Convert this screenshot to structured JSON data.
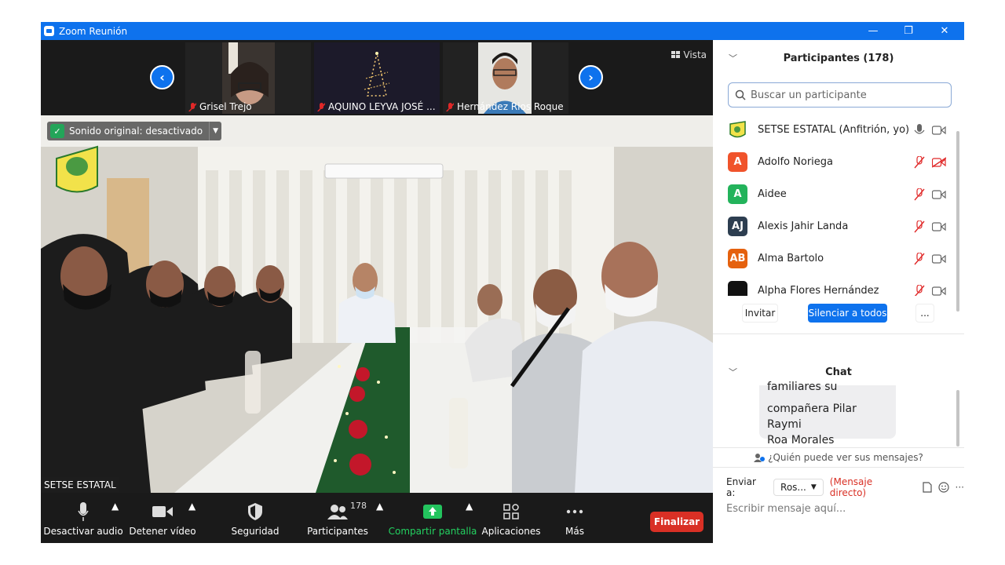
{
  "titlebar": {
    "title": "Zoom Reunión",
    "minimize": "—",
    "restore": "❐",
    "close": "✕"
  },
  "thumbs": {
    "prev": "‹",
    "next": "›",
    "view_label": "Vista",
    "tiles": [
      {
        "name": "Grisel Trejo"
      },
      {
        "name": "AQUINO LEYVA JOSÉ ..."
      },
      {
        "name": "Hernández Rios Roque"
      }
    ]
  },
  "main": {
    "audio_badge": "Sonido original: desactivado",
    "speaker_name": "SETSE ESTATAL"
  },
  "toolbar": {
    "mute_label": "Desactivar audio",
    "video_label": "Detener vídeo",
    "security_label": "Seguridad",
    "participants_label": "Participantes",
    "participants_count": "178",
    "share_label": "Compartir pantalla",
    "apps_label": "Aplicaciones",
    "more_label": "Más",
    "end_label": "Finalizar"
  },
  "participants": {
    "header": "Participantes (178)",
    "search_placeholder": "Buscar un participante",
    "list": [
      {
        "initials": "",
        "name": "SETSE ESTATAL (Anfitrión, yo)",
        "color": "#ffffff"
      },
      {
        "initials": "A",
        "name": "Adolfo Noriega",
        "color": "#f0532b"
      },
      {
        "initials": "A",
        "name": "Aidee",
        "color": "#23b35b"
      },
      {
        "initials": "AJ",
        "name": "Alexis Jahir Landa",
        "color": "#2d3e50"
      },
      {
        "initials": "AB",
        "name": "Alma Bartolo",
        "color": "#e5610e"
      },
      {
        "initials": "",
        "name": "Alpha Flores Hernández",
        "color": "#111111"
      }
    ],
    "invite": "Invitar",
    "mute_all": "Silenciar a todos",
    "more": "..."
  },
  "chat": {
    "header": "Chat",
    "bubble_first": "familiares su",
    "bubble_line2": "compañera Pilar Raymi",
    "bubble_line3": "Roa Morales",
    "who_can_see": "¿Quién puede ver sus mensajes?",
    "send_to_label": "Enviar a:",
    "recipient": "Ros...",
    "direct": "(Mensaje directo)",
    "input_placeholder": "Escribir mensaje aquí..."
  }
}
